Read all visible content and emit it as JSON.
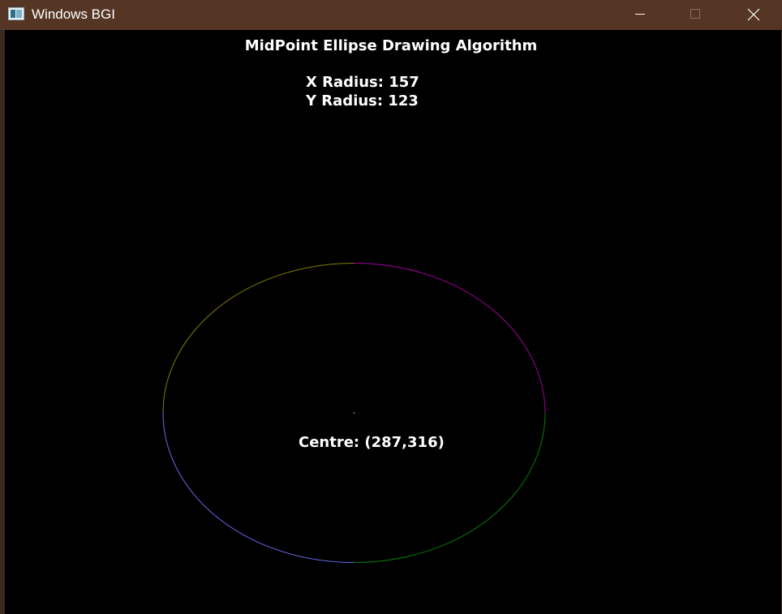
{
  "window": {
    "title": "Windows BGI",
    "colors": {
      "titlebar": "#553624",
      "canvas": "#000000"
    }
  },
  "controls": {
    "minimize_icon": "minimize-icon",
    "maximize_icon": "maximize-icon",
    "close_icon": "close-icon"
  },
  "canvas": {
    "heading": "MidPoint Ellipse Drawing Algorithm",
    "x_radius_text": "X Radius: 157",
    "y_radius_text": "Y Radius: 123",
    "centre_text": "Centre: (287,316)"
  },
  "ellipse": {
    "center": [
      287,
      316
    ],
    "rx": 157,
    "ry": 123,
    "quadrant_colors": {
      "top_left": "#808000",
      "top_right": "#a000a0",
      "bottom_left": "#6a6af0",
      "bottom_right": "#008000"
    },
    "center_dot_color": "#a0a0a0"
  }
}
